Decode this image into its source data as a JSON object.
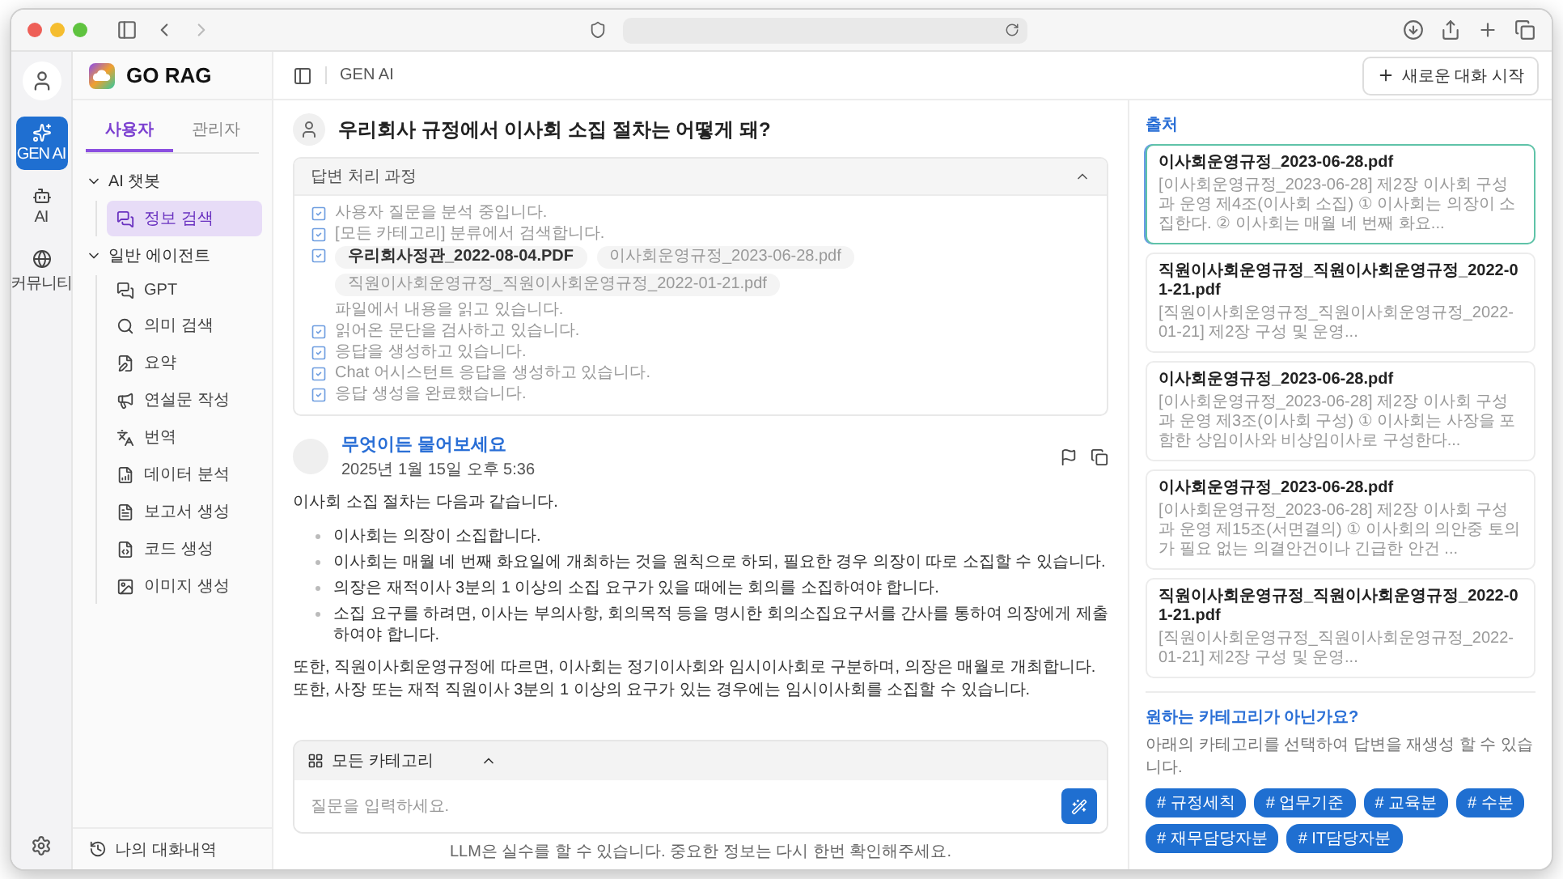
{
  "rail": {
    "items": [
      {
        "kind": "genai",
        "label": "GEN AI",
        "selected": true
      },
      {
        "kind": "ai",
        "label": "AI",
        "selected": false
      },
      {
        "kind": "community",
        "label": "커뮤니티",
        "selected": false
      }
    ]
  },
  "sidebar": {
    "logo": "GO RAG",
    "tabs": [
      {
        "label": "사용자",
        "selected": true
      },
      {
        "label": "관리자",
        "selected": false
      }
    ],
    "groups": [
      {
        "label": "AI 챗봇",
        "expanded": true,
        "children": [
          {
            "kind": "chat",
            "label": "정보 검색",
            "selected": true
          }
        ]
      },
      {
        "label": "일반 에이전트",
        "expanded": true,
        "children": [
          {
            "kind": "chat",
            "label": "GPT",
            "selected": false
          },
          {
            "kind": "search",
            "label": "의미 검색",
            "selected": false
          },
          {
            "kind": "summary",
            "label": "요약",
            "selected": false
          },
          {
            "kind": "speech",
            "label": "연설문 작성",
            "selected": false
          },
          {
            "kind": "translate",
            "label": "번역",
            "selected": false
          },
          {
            "kind": "data",
            "label": "데이터 분석",
            "selected": false
          },
          {
            "kind": "report",
            "label": "보고서 생성",
            "selected": false
          },
          {
            "kind": "code",
            "label": "코드 생성",
            "selected": false
          },
          {
            "kind": "image",
            "label": "이미지 생성",
            "selected": false
          }
        ]
      }
    ],
    "history": "나의 대화내역"
  },
  "header": {
    "title": "GEN AI",
    "new_chat": "새로운 대화 시작"
  },
  "question": "우리회사 규정에서 이사회 소집 절차는 어떻게 돼?",
  "process": {
    "title": "답변 처리 과정",
    "expanded": true,
    "steps": [
      {
        "kind": "text",
        "text": "사용자 질문을 분석 중입니다.",
        "checked": true
      },
      {
        "kind": "text",
        "text": "[모든 카테고리] 분류에서 검색합니다.",
        "checked": true
      },
      {
        "kind": "files",
        "files": [
          {
            "name": "우리회사정관_2022-08-04.PDF",
            "highlighted": true
          },
          {
            "name": "이사회운영규정_2023-06-28.pdf",
            "highlighted": false
          },
          {
            "name": "직원이사회운영규정_직원이사회운영규정_2022-01-21.pdf",
            "highlighted": false
          }
        ],
        "text": "파일에서 내용을 읽고 있습니다.",
        "checked": true
      },
      {
        "kind": "text",
        "text": "읽어온 문단을 검사하고 있습니다.",
        "checked": true
      },
      {
        "kind": "text",
        "text": "응답을 생성하고 있습니다.",
        "checked": true
      },
      {
        "kind": "text",
        "text": "Chat 어시스턴트 응답을 생성하고 있습니다.",
        "checked": true
      },
      {
        "kind": "text",
        "text": "응답 생성을 완료했습니다.",
        "checked": true
      }
    ]
  },
  "answer": {
    "name": "무엇이든 물어보세요",
    "time": "2025년 1월 15일 오후 5:36",
    "intro": "이사회 소집 절차는 다음과 같습니다.",
    "bullets": [
      "이사회는 의장이 소집합니다.",
      "이사회는 매월 네 번째 화요일에 개최하는 것을 원칙으로 하되, 필요한 경우 의장이 따로 소집할 수 있습니다.",
      "의장은 재적이사 3분의 1 이상의 소집 요구가 있을 때에는 회의를 소집하여야 합니다.",
      "소집 요구를 하려면, 이사는 부의사항, 회의목적 등을 명시한 회의소집요구서를 간사를 통하여 의장에게 제출하여야 합니다."
    ],
    "paragraph": "또한, 직원이사회운영규정에 따르면, 이사회는 정기이사회와 임시이사회로 구분하며, 의장은 매월로 개최합니다. 또한, 사장 또는 재적 직원이사 3분의 1 이상의 요구가 있는 경우에는 임시이사회를 소집할 수 있습니다."
  },
  "sources": {
    "title": "출처",
    "items": [
      {
        "title": "이사회운영규정_2023-06-28.pdf",
        "snippet": "[이사회운영규정_2023-06-28] 제2장 이사회 구성과 운영 제4조(이사회 소집) ① 이사회는 의장이 소집한다. ② 이사회는 매월 네 번째 화요...",
        "selected": true
      },
      {
        "title": "직원이사회운영규정_직원이사회운영규정_2022-01-21.pdf",
        "snippet": "[직원이사회운영규정_직원이사회운영규정_2022-01-21] 제2장 구성 및 운영...",
        "selected": false
      },
      {
        "title": "이사회운영규정_2023-06-28.pdf",
        "snippet": "[이사회운영규정_2023-06-28] 제2장 이사회 구성과 운영 제3조(이사회 구성) ① 이사회는 사장을 포함한 상임이사와 비상임이사로 구성한다...",
        "selected": false
      },
      {
        "title": "이사회운영규정_2023-06-28.pdf",
        "snippet": "[이사회운영규정_2023-06-28] 제2장 이사회 구성과 운영 제15조(서면결의) ① 이사회의 의안중 토의가 필요 없는 의결안건이나 긴급한 안건 ...",
        "selected": false
      },
      {
        "title": "직원이사회운영규정_직원이사회운영규정_2022-01-21.pdf",
        "snippet": "[직원이사회운영규정_직원이사회운영규정_2022-01-21] 제2장 구성 및 운영...",
        "selected": false
      }
    ]
  },
  "category_hint": {
    "title": "원하는 카테고리가 아닌가요?",
    "description": "아래의 카테고리를 선택하여 답변을 재생성 할 수 있습니다.",
    "tags": [
      "# 규정세칙",
      "# 업무기준",
      "# 교육분",
      "# 수분",
      "# 재무담당자분",
      "# IT담당자분"
    ]
  },
  "composer": {
    "category": "모든 카테고리",
    "category_expanded": true,
    "placeholder": "질문을 입력하세요.",
    "note": "LLM은 실수를 할 수 있습니다. 중요한 정보는 다시 한번 확인해주세요."
  }
}
